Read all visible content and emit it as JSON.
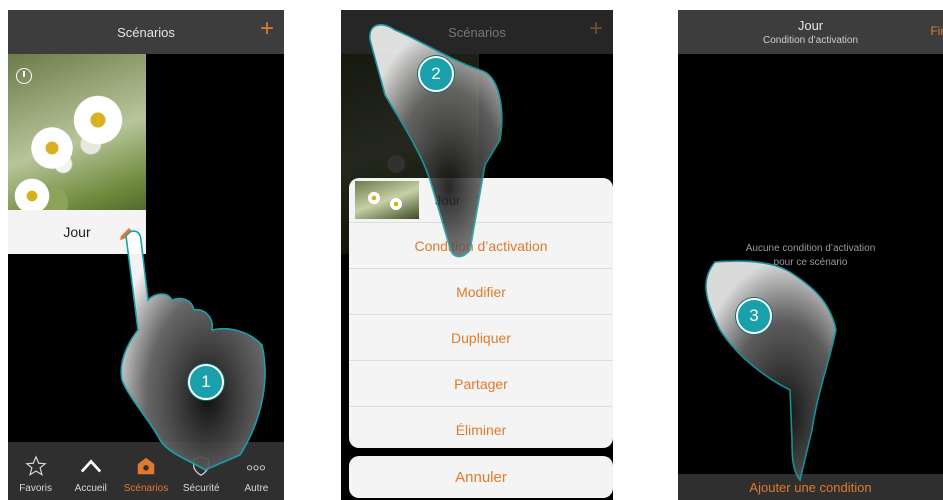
{
  "screen1": {
    "title": "Scénarios",
    "plus_icon": "plus-icon",
    "scenario_name": "Jour",
    "tabs": [
      {
        "label": "Favoris",
        "icon": "star-icon"
      },
      {
        "label": "Accueil",
        "icon": "home-icon"
      },
      {
        "label": "Scénarios",
        "icon": "scenario-icon",
        "active": true
      },
      {
        "label": "Sécurité",
        "icon": "shield-icon"
      },
      {
        "label": "Autre",
        "icon": "more-icon"
      }
    ],
    "step": "1"
  },
  "screen2": {
    "title": "Scénarios",
    "sheet_title": "Jour",
    "options": [
      "Condition d’activation",
      "Modifier",
      "Dupliquer",
      "Partager",
      "Éliminer"
    ],
    "cancel": "Annuler",
    "step": "2"
  },
  "screen3": {
    "title": "Jour",
    "subtitle": "Condition d’activation",
    "finish": "Fin",
    "empty_line1": "Aucune condition d’activation",
    "empty_line2": "pour ce scénario",
    "add_condition": "Ajouter une condition",
    "step": "3"
  },
  "colors": {
    "accent": "#e07a2f",
    "step_badge": "#1aa0aa",
    "bar": "#3d3d3d"
  }
}
